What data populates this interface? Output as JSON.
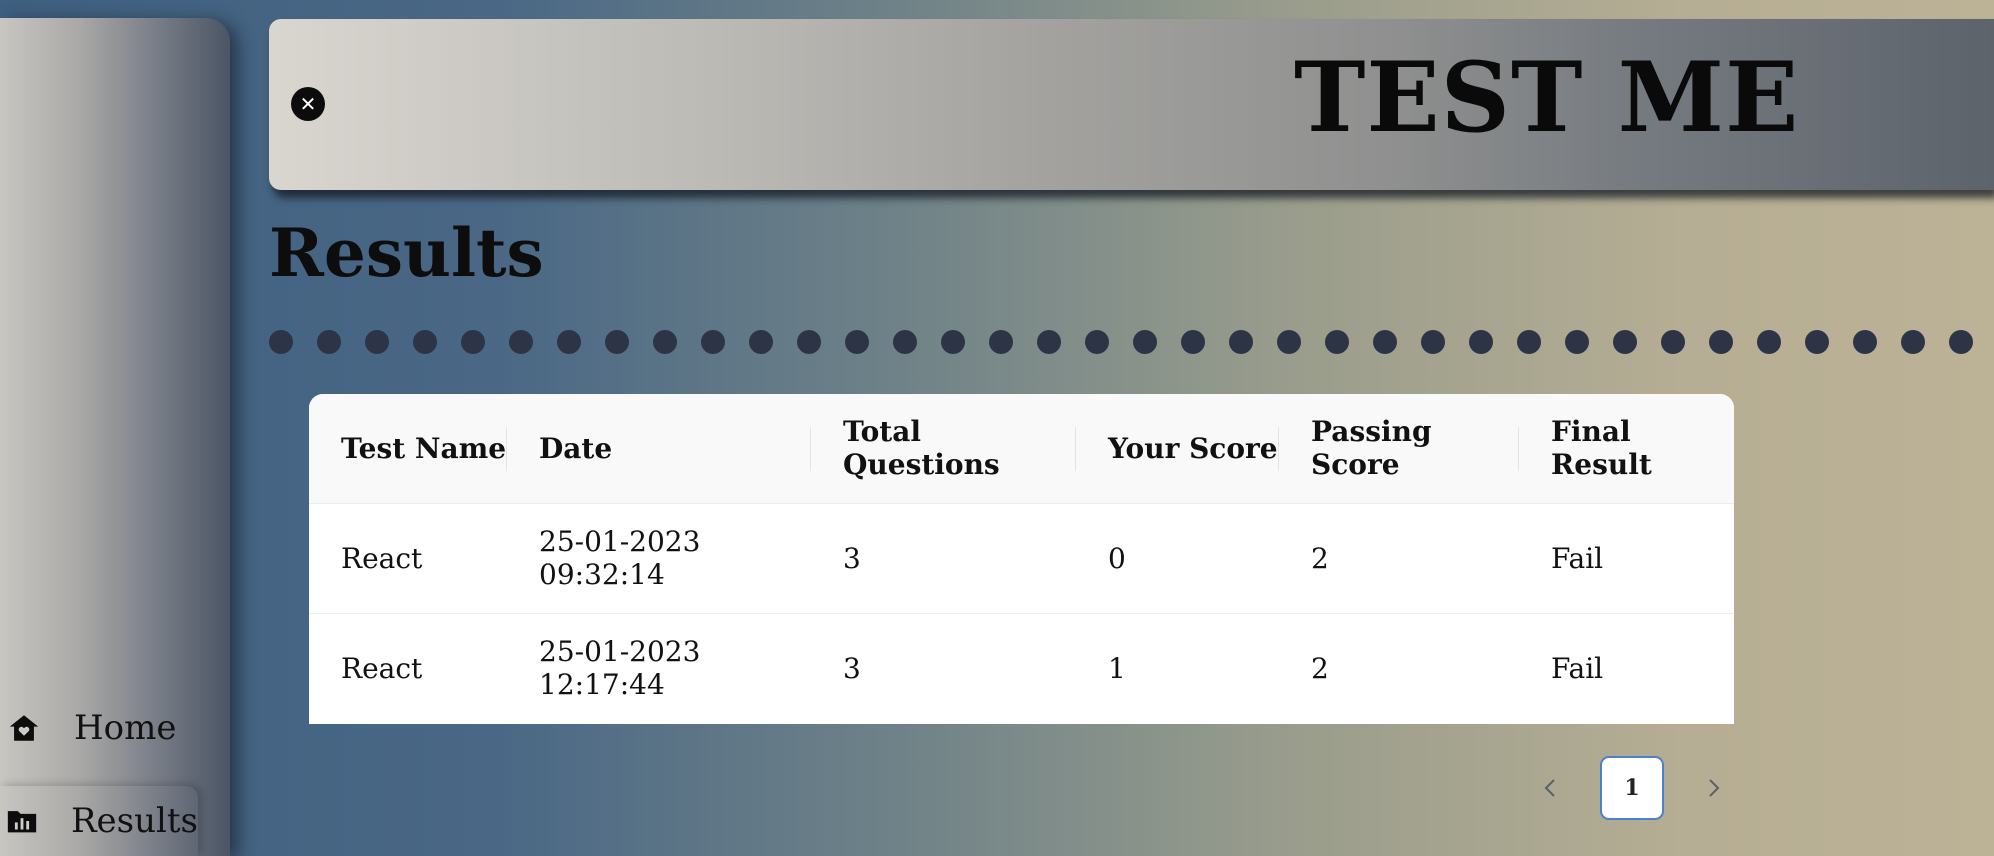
{
  "app": {
    "title": "TEST ME"
  },
  "header": {
    "close_icon": "close-icon"
  },
  "sidebar": {
    "items": [
      {
        "label": "Home",
        "icon": "home-heart-icon"
      },
      {
        "label": "Results",
        "icon": "chart-folder-icon"
      }
    ]
  },
  "page": {
    "title": "Results"
  },
  "results_table": {
    "columns": [
      "Test Name",
      "Date",
      "Total Questions",
      "Your Score",
      "Passing Score",
      "Final Result"
    ],
    "rows": [
      [
        "React",
        "25-01-2023 09:32:14",
        "3",
        "0",
        "2",
        "Fail"
      ],
      [
        "React",
        "25-01-2023 12:17:44",
        "3",
        "1",
        "2",
        "Fail"
      ]
    ]
  },
  "pagination": {
    "current_page": "1",
    "prev_icon": "chevron-left-icon",
    "next_icon": "chevron-right-icon"
  },
  "colors": {
    "dot": "#2c3445",
    "active_page_border": "#4b7fd0"
  }
}
